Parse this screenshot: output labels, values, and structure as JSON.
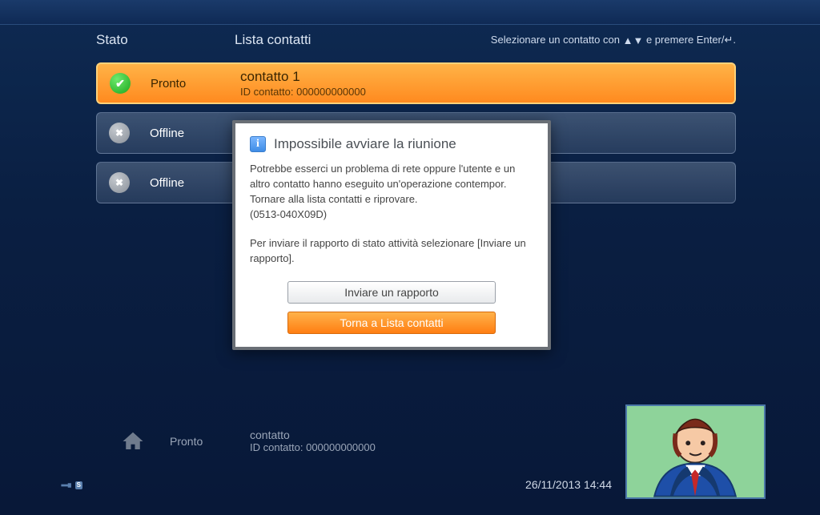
{
  "header": {
    "stato_label": "Stato",
    "lista_label": "Lista contatti",
    "hint_prefix": "Selezionare un contatto con ",
    "hint_suffix": " e premere Enter/↵."
  },
  "contacts": [
    {
      "status": "ready",
      "status_text": "Pronto",
      "name": "contatto 1",
      "id_label": "ID contatto: 000000000000",
      "selected": true
    },
    {
      "status": "offline",
      "status_text": "Offline"
    },
    {
      "status": "offline",
      "status_text": "Offline"
    }
  ],
  "modal": {
    "title": "Impossibile avviare la riunione",
    "body_line1": "Potrebbe esserci un problema di rete oppure l'utente e un altro contatto hanno eseguito un'operazione contempor. Tornare alla lista contatti e riprovare.",
    "body_code": "(0513-040X09D)",
    "body_line2": "Per inviare il rapporto di stato attività selezionare [Inviare un rapporto].",
    "btn_report": "Inviare un rapporto",
    "btn_back": "Torna a Lista contatti"
  },
  "footer": {
    "pronto": "Pronto",
    "contact_label": "contatto",
    "contact_id": "ID contatto: 000000000000",
    "datetime": "26/11/2013 14:44"
  }
}
